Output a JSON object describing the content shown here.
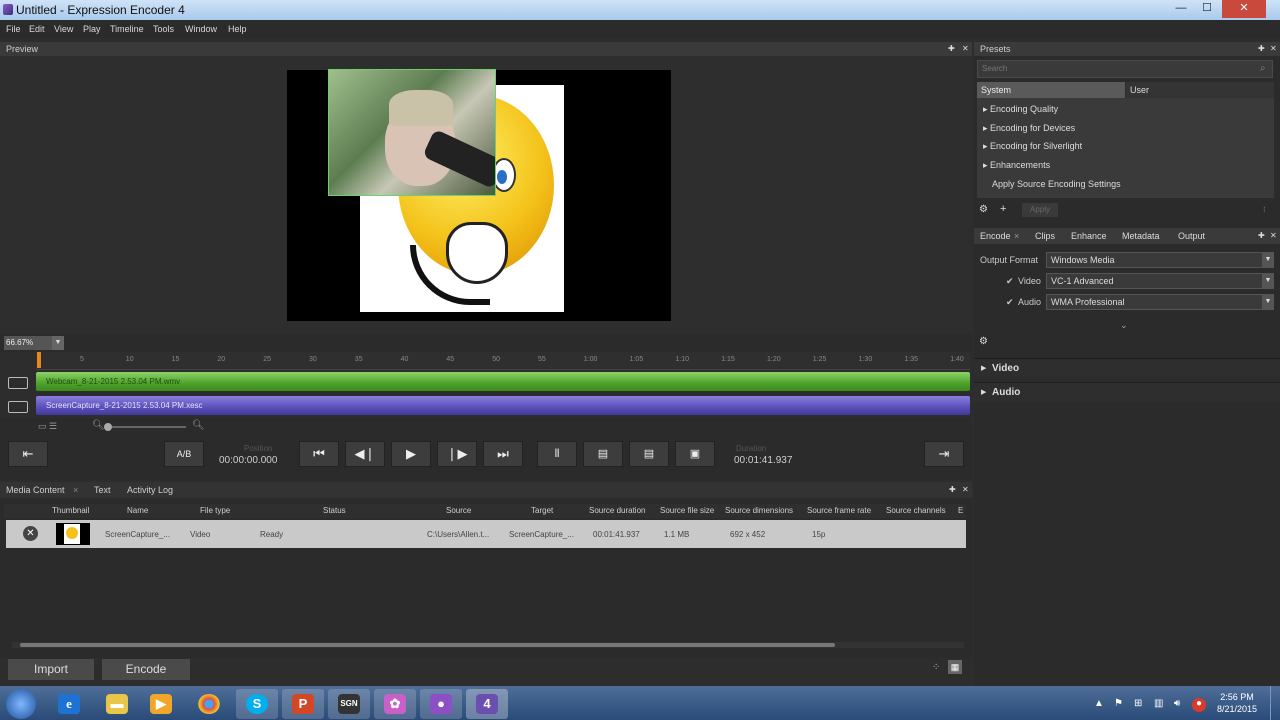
{
  "window": {
    "title": "Untitled - Expression Encoder 4",
    "min": "—",
    "max": "☐",
    "close": "✕"
  },
  "menu": [
    "File",
    "Edit",
    "View",
    "Play",
    "Timeline",
    "Tools",
    "Window",
    "Help"
  ],
  "preview": {
    "header": "Preview",
    "zoom": "66.67%"
  },
  "timeline": {
    "ticks": [
      "5",
      "10",
      "15",
      "20",
      "25",
      "30",
      "35",
      "40",
      "45",
      "50",
      "55",
      "1:00",
      "1:05",
      "1:10",
      "1:15",
      "1:20",
      "1:25",
      "1:30",
      "1:35",
      "1:40"
    ],
    "tracks": [
      "Webcam_8-21-2015 2.53.04 PM.wmv",
      "ScreenCapture_8-21-2015 2.53.04 PM.xesc"
    ]
  },
  "transport": {
    "ab_label": "A/B",
    "position_label": "Position",
    "position": "00:00:00.000",
    "duration_label": "Duration",
    "duration": "00:01:41.937"
  },
  "media": {
    "tabs": [
      "Media Content",
      "Text",
      "Activity Log"
    ],
    "columns": [
      "Thumbnail",
      "Name",
      "File type",
      "Status",
      "Source",
      "Target",
      "Source duration",
      "Source file size",
      "Source dimensions",
      "Source frame rate",
      "Source channels",
      "E"
    ],
    "row": {
      "name": "ScreenCapture_...",
      "file_type": "Video",
      "status": "Ready",
      "source": "C:\\Users\\Allen.t...",
      "target": "ScreenCapture_...",
      "duration": "00:01:41.937",
      "size": "1.1 MB",
      "dimensions": "692 x 452",
      "frame_rate": "15p"
    },
    "import_label": "Import",
    "encode_label": "Encode"
  },
  "presets": {
    "header": "Presets",
    "search_placeholder": "Search",
    "tabs": [
      "System",
      "User"
    ],
    "items": [
      "Encoding Quality",
      "Encoding for Devices",
      "Encoding for Silverlight",
      "Enhancements",
      "Apply Source Encoding Settings"
    ],
    "apply_label": "Apply"
  },
  "encode": {
    "tabs": [
      "Encode",
      "Clips",
      "Enhance",
      "Metadata",
      "Output"
    ],
    "output_format_label": "Output Format",
    "output_format": "Windows Media",
    "video_label": "Video",
    "video_codec": "VC-1 Advanced",
    "audio_label": "Audio",
    "audio_codec": "WMA Professional",
    "sections": [
      "Video",
      "Audio"
    ]
  },
  "taskbar": {
    "time": "2:56 PM",
    "date": "8/21/2015"
  }
}
